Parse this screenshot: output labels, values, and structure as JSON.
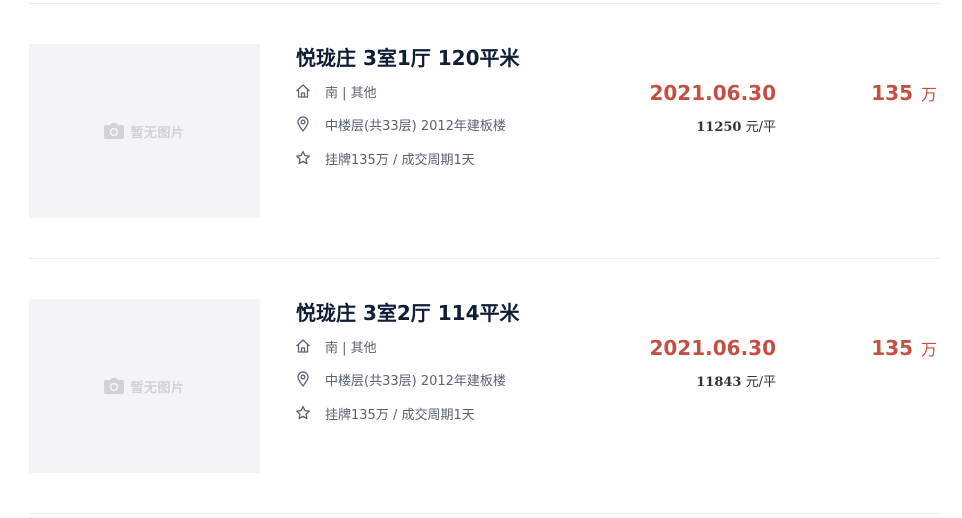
{
  "theme": {
    "price_color": "#c44f44",
    "title_color": "#101d37",
    "placeholder_bg": "#f4f4f6"
  },
  "listings": [
    {
      "placeholder": "暂无图片",
      "title": "悦珑庄 3室1厅 120平米",
      "house_info": "南 | 其他",
      "position_info": "中楼层(共33层) 2012年建板楼",
      "deal_cycle": "挂牌135万 / 成交周期1天",
      "deal_date": "2021.06.30",
      "unit_price": "11250",
      "unit_price_suffix": "元/平",
      "total_price": "135",
      "total_price_unit": "万",
      "icons": {
        "house": "home-icon",
        "position": "location-pin-icon",
        "deal": "star-icon",
        "photo": "camera-icon"
      }
    },
    {
      "placeholder": "暂无图片",
      "title": "悦珑庄 3室2厅 114平米",
      "house_info": "南 | 其他",
      "position_info": "中楼层(共33层) 2012年建板楼",
      "deal_cycle": "挂牌135万 / 成交周期1天",
      "deal_date": "2021.06.30",
      "unit_price": "11843",
      "unit_price_suffix": "元/平",
      "total_price": "135",
      "total_price_unit": "万",
      "icons": {
        "house": "home-icon",
        "position": "location-pin-icon",
        "deal": "star-icon",
        "photo": "camera-icon"
      }
    }
  ]
}
